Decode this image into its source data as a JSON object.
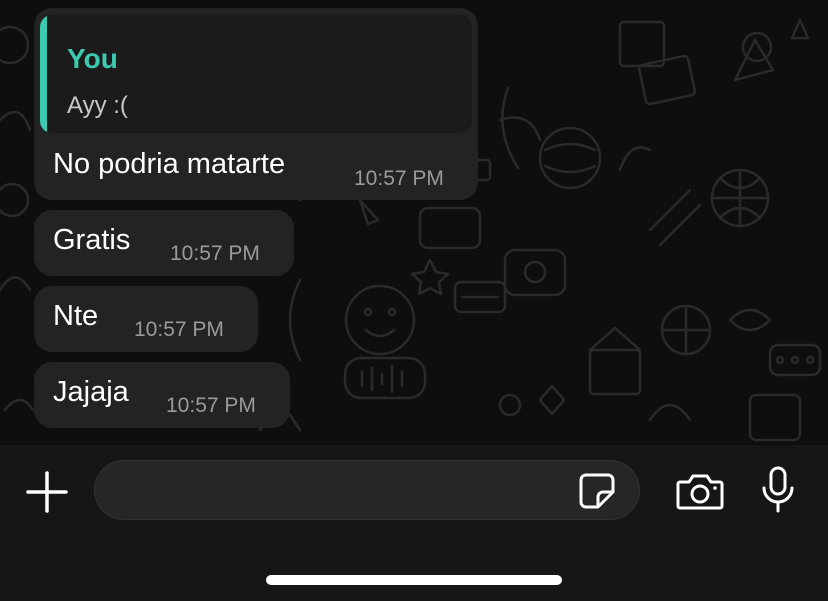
{
  "chat": {
    "messages": [
      {
        "quote": {
          "author": "You",
          "text": "Ayy :("
        },
        "text": "No podria matarte",
        "time": "10:57 PM"
      },
      {
        "text": "Gratis",
        "time": "10:57 PM"
      },
      {
        "text": "Nte",
        "time": "10:57 PM"
      },
      {
        "text": "Jajaja",
        "time": "10:57 PM"
      }
    ]
  },
  "composer": {
    "message_value": "",
    "icons": {
      "attach": "plus-icon",
      "sticker": "sticker-icon",
      "camera": "camera-icon",
      "voice": "microphone-icon"
    }
  },
  "colors": {
    "background": "#0b0b0b",
    "bubble": "#232323",
    "quote_accent": "#3bc9b0",
    "timestamp": "#9a9a9a",
    "composer_bar": "#161616"
  }
}
